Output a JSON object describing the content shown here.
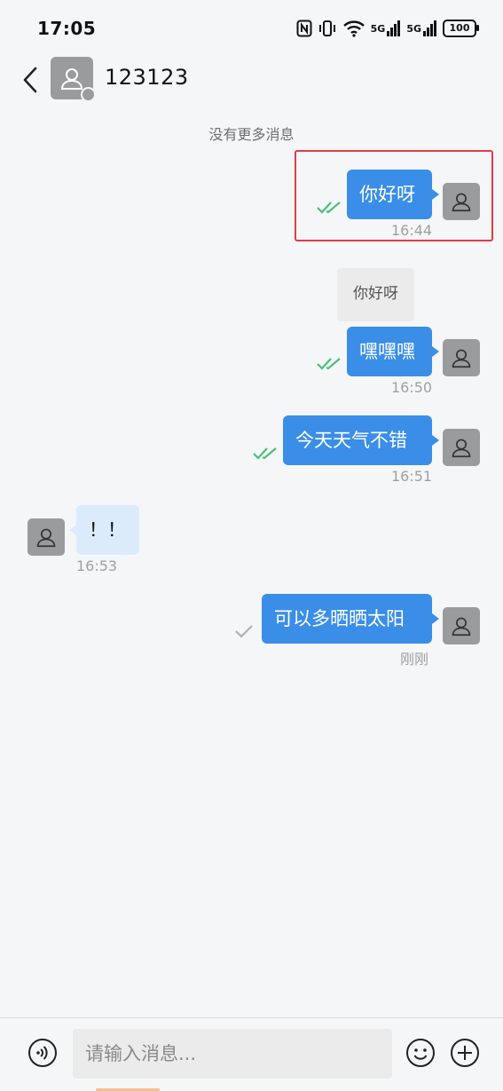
{
  "status_bar": {
    "time": "17:05",
    "net1": "5G",
    "net2": "5G",
    "battery": "100"
  },
  "header": {
    "title": "123123"
  },
  "no_more_label": "没有更多消息",
  "messages": [
    {
      "direction": "out",
      "text": "你好呀",
      "time": "16:44",
      "status": "read"
    },
    {
      "direction": "out",
      "quote": "你好呀",
      "text": "嘿嘿嘿",
      "time": "16:50",
      "status": "read"
    },
    {
      "direction": "out",
      "text": "今天天气不错",
      "time": "16:51",
      "status": "read"
    },
    {
      "direction": "in",
      "text": "！！",
      "time": "16:53"
    },
    {
      "direction": "out",
      "text": "可以多晒晒太阳",
      "time": "刚刚",
      "status": "sent"
    }
  ],
  "input": {
    "placeholder": "请输入消息..."
  },
  "colors": {
    "bubble_out": "#3a8ee8",
    "bubble_in": "#dcebfb",
    "read_check": "#4cbf7a",
    "sent_check": "#b0b0b0",
    "highlight": "#e63946"
  }
}
